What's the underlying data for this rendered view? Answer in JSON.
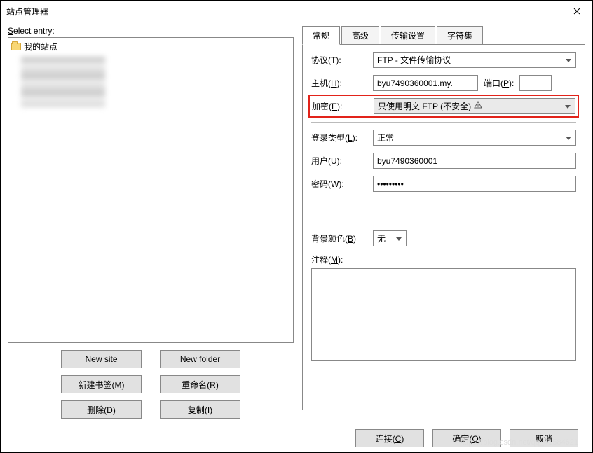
{
  "window": {
    "title": "站点管理器"
  },
  "left": {
    "select_entry": "Select entry:",
    "root_folder": "我的站点",
    "buttons": {
      "new_site": "New site",
      "new_folder": "New folder",
      "new_bookmark": "新建书签(M)",
      "rename": "重命名(R)",
      "delete": "删除(D)",
      "copy": "复制(I)"
    }
  },
  "tabs": {
    "general": "常规",
    "advanced": "高级",
    "transfer": "传输设置",
    "charset": "字符集"
  },
  "general": {
    "protocol_label": "协议(T):",
    "protocol_value": "FTP - 文件传输协议",
    "host_label": "主机(H):",
    "host_value": "byu7490360001.my.",
    "port_label": "端口(P):",
    "port_value": "",
    "encryption_label": "加密(E):",
    "encryption_value": "只使用明文 FTP (不安全)",
    "logon_label": "登录类型(L):",
    "logon_value": "正常",
    "user_label": "用户(U):",
    "user_value": "byu7490360001",
    "password_label": "密码(W):",
    "password_value": "•••••••••",
    "bgcolor_label": "背景颜色(B)",
    "bgcolor_value": "无",
    "comment_label": "注释(M):",
    "comment_value": ""
  },
  "footer": {
    "connect": "连接(C)",
    "ok": "确定(O)",
    "cancel": "取消"
  },
  "watermark": "https://blog.csdn.net/qq_41584621"
}
